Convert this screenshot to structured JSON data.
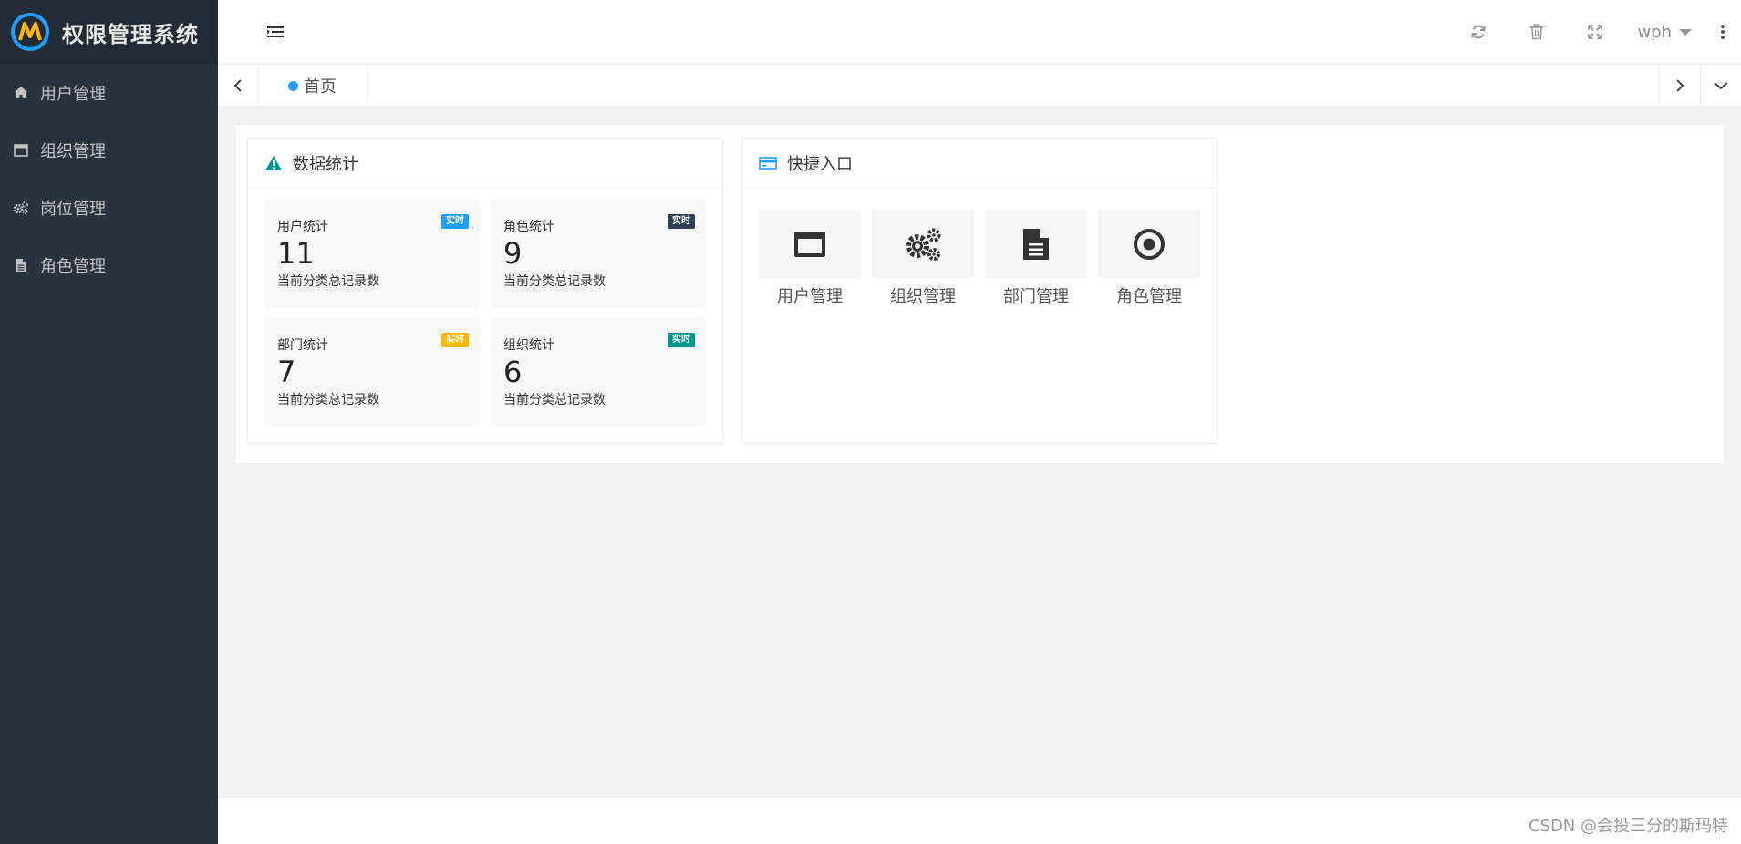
{
  "app": {
    "title": "权限管理系统"
  },
  "sidebar": {
    "items": [
      {
        "label": "用户管理",
        "icon": "home-icon"
      },
      {
        "label": "组织管理",
        "icon": "window-icon"
      },
      {
        "label": "岗位管理",
        "icon": "gears-icon"
      },
      {
        "label": "角色管理",
        "icon": "document-icon"
      }
    ]
  },
  "header": {
    "icons": [
      "refresh-icon",
      "trash-icon",
      "fullscreen-icon"
    ],
    "user": "wph"
  },
  "tabs": {
    "home_label": "首页"
  },
  "stats_card": {
    "title": "数据统计",
    "items": [
      {
        "title": "用户统计",
        "value": "11",
        "desc": "当前分类总记录数",
        "badge": "实时",
        "badge_color": "#1e9fff"
      },
      {
        "title": "角色统计",
        "value": "9",
        "desc": "当前分类总记录数",
        "badge": "实时",
        "badge_color": "#2f4056"
      },
      {
        "title": "部门统计",
        "value": "7",
        "desc": "当前分类总记录数",
        "badge": "实时",
        "badge_color": "#ffb800"
      },
      {
        "title": "组织统计",
        "value": "6",
        "desc": "当前分类总记录数",
        "badge": "实时",
        "badge_color": "#009688"
      }
    ]
  },
  "quick_card": {
    "title": "快捷入口",
    "items": [
      {
        "label": "用户管理",
        "icon": "window-icon"
      },
      {
        "label": "组织管理",
        "icon": "gears-icon"
      },
      {
        "label": "部门管理",
        "icon": "document-icon"
      },
      {
        "label": "角色管理",
        "icon": "target-icon"
      }
    ]
  },
  "footer": {
    "watermark": "CSDN @会投三分的斯玛特"
  },
  "colors": {
    "sidebar": "#28333e",
    "logo_bar": "#222c36",
    "accent": "#1e9fff"
  }
}
